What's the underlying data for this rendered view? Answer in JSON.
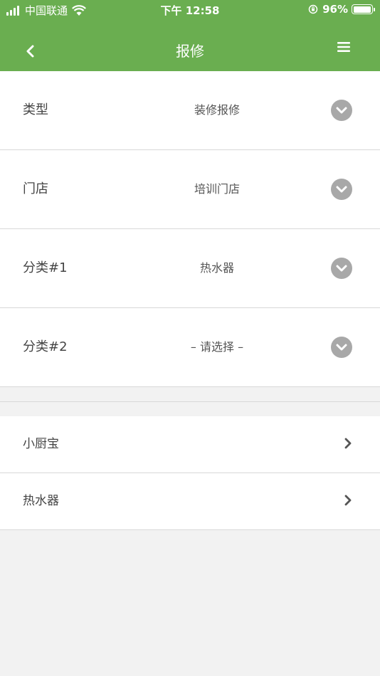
{
  "status_bar": {
    "carrier": "中国联通",
    "time": "下午 12:58",
    "battery": "96%",
    "battery_level": 0.96
  },
  "nav": {
    "title": "报修",
    "back_icon": "chevron-left-icon",
    "menu_icon": "hamburger-menu-icon"
  },
  "form": {
    "rows": [
      {
        "label": "类型",
        "value": "装修报修"
      },
      {
        "label": "门店",
        "value": "培训门店"
      },
      {
        "label": "分类#1",
        "value": "热水器"
      },
      {
        "label": "分类#2",
        "value": "– 请选择 –"
      }
    ]
  },
  "list": {
    "items": [
      {
        "label": "小厨宝"
      },
      {
        "label": "热水器"
      }
    ]
  },
  "colors": {
    "header": "#6aae50",
    "chevron_circle": "#a8a8a8",
    "background": "#f2f2f2"
  }
}
